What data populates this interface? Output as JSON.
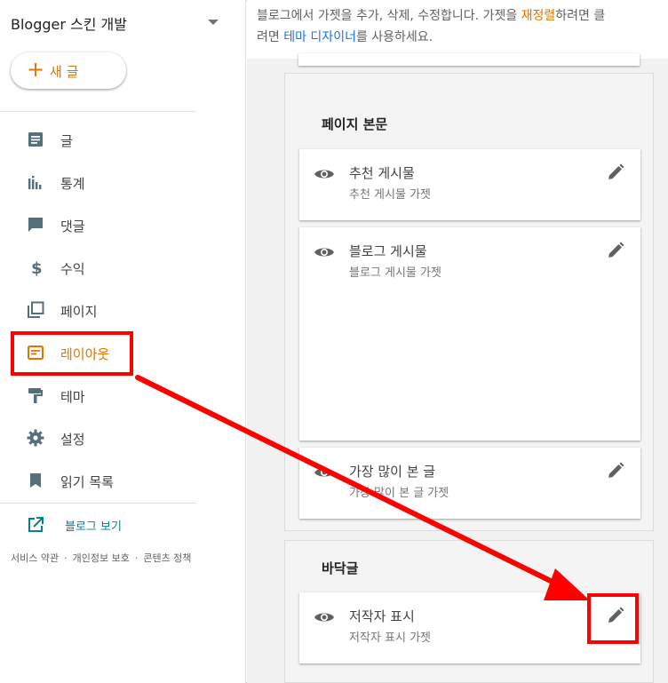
{
  "sidebar": {
    "blog_title": "Blogger 스킨 개발",
    "new_post_label": "새 글",
    "items": [
      {
        "label": "글",
        "icon": "posts-icon"
      },
      {
        "label": "통계",
        "icon": "stats-icon"
      },
      {
        "label": "댓글",
        "icon": "comments-icon"
      },
      {
        "label": "수익",
        "icon": "earnings-icon"
      },
      {
        "label": "페이지",
        "icon": "pages-icon"
      },
      {
        "label": "레이아웃",
        "icon": "layout-icon"
      },
      {
        "label": "테마",
        "icon": "theme-icon"
      },
      {
        "label": "설정",
        "icon": "settings-icon"
      },
      {
        "label": "읽기 목록",
        "icon": "reading-list-icon"
      }
    ],
    "active_item": "레이아웃",
    "view_blog_label": "블로그 보기",
    "footer_links": [
      "서비스 약관",
      "개인정보 보호",
      "콘텐츠 정책"
    ]
  },
  "main": {
    "description": {
      "part1": "블로그에서 가젯을 추가, 삭제, 수정합니다. 가젯을 ",
      "highlight": "재정렬",
      "part2": "하려면 클",
      "line2_prefix": "려면 ",
      "link": "테마 디자이너",
      "line2_suffix": "를 사용하세요."
    },
    "sections": [
      {
        "title": "페이지 본문",
        "widgets": [
          {
            "name": "추천 게시물",
            "subtitle": "추천 게시물 가젯"
          },
          {
            "name": "블로그 게시물",
            "subtitle": "블로그 게시물 가젯"
          },
          {
            "name": "가장 많이 본 글",
            "subtitle": "가장 많이 본 글 가젯"
          }
        ]
      },
      {
        "title": "바닥글",
        "widgets": [
          {
            "name": "저작자 표시",
            "subtitle": "저작자 표시 가젯"
          }
        ]
      }
    ]
  },
  "colors": {
    "accent": "#e37400",
    "link": "#1a73e8",
    "annotation": "#ff0000",
    "view_blog": "#00838f"
  }
}
